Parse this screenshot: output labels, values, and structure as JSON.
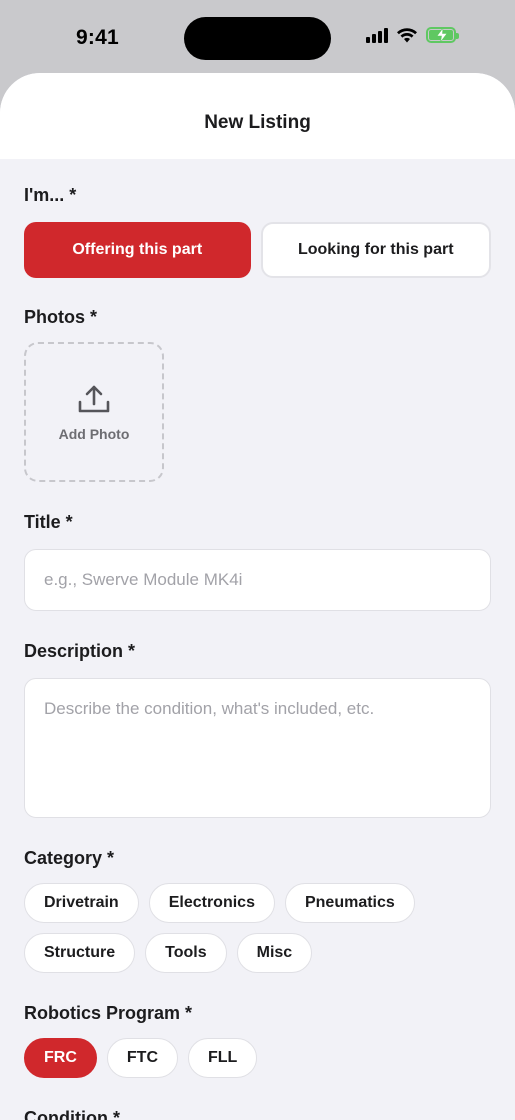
{
  "status_bar": {
    "time": "9:41"
  },
  "sheet": {
    "title": "New Listing"
  },
  "intent": {
    "label": "I'm... *",
    "options": [
      {
        "label": "Offering this part",
        "selected": true
      },
      {
        "label": "Looking for this part",
        "selected": false
      }
    ]
  },
  "photos": {
    "label": "Photos *",
    "add_label": "Add Photo"
  },
  "title_field": {
    "label": "Title *",
    "placeholder": "e.g., Swerve Module MK4i"
  },
  "description_field": {
    "label": "Description *",
    "placeholder": "Describe the condition, what's included, etc."
  },
  "category": {
    "label": "Category *",
    "options": [
      "Drivetrain",
      "Electronics",
      "Pneumatics",
      "Structure",
      "Tools",
      "Misc"
    ]
  },
  "program": {
    "label": "Robotics Program *",
    "options": [
      {
        "label": "FRC",
        "selected": true
      },
      {
        "label": "FTC",
        "selected": false
      },
      {
        "label": "FLL",
        "selected": false
      }
    ]
  },
  "condition": {
    "label": "Condition *"
  },
  "colors": {
    "accent": "#d0282c",
    "background": "#f2f2f7",
    "battery": "#5fc862"
  }
}
